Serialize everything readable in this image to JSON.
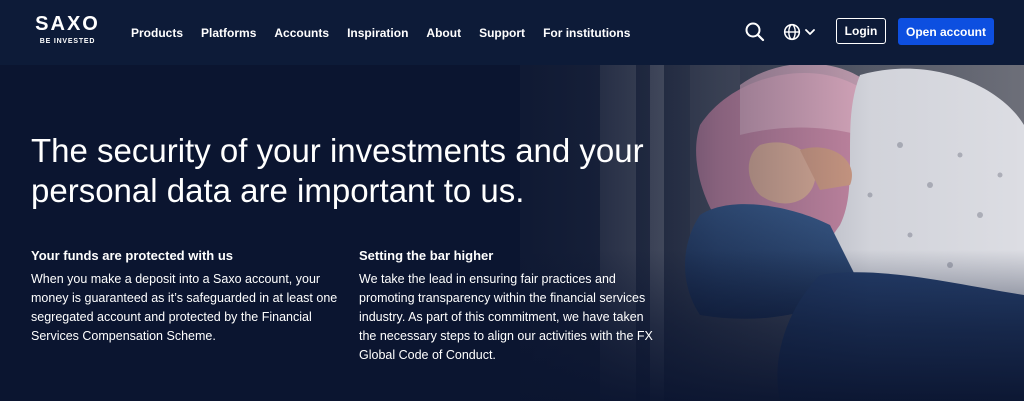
{
  "header": {
    "logo": {
      "wordmark": "SAXO",
      "tagline": "BE INVESTED"
    },
    "nav": [
      {
        "label": "Products"
      },
      {
        "label": "Platforms"
      },
      {
        "label": "Accounts"
      },
      {
        "label": "Inspiration"
      },
      {
        "label": "About"
      },
      {
        "label": "Support"
      },
      {
        "label": "For institutions"
      }
    ],
    "icons": {
      "search": "search-icon",
      "language": "globe-icon",
      "language_menu": "chevron-down-icon"
    },
    "login_label": "Login",
    "open_account_label": "Open account"
  },
  "hero": {
    "title": "The security of your investments and your personal data are important to us.",
    "columns": [
      {
        "heading": "Your funds are protected with us",
        "body": "When you make a deposit into a Saxo account, your money is guaranteed as it’s safeguarded in at least one segregated account and protected by the Financial Services Compensation Scheme."
      },
      {
        "heading": "Setting the bar higher",
        "body": "We take the lead in ensuring fair practices and promoting transparency within the financial services industry. As part of this commitment, we have taken the necessary steps to align our activities with the FX Global Code of Conduct."
      }
    ]
  },
  "colors": {
    "header_bg": "#0d1b38",
    "hero_bg": "#0b1530",
    "primary_button": "#0d4fe0",
    "text": "#ffffff"
  }
}
